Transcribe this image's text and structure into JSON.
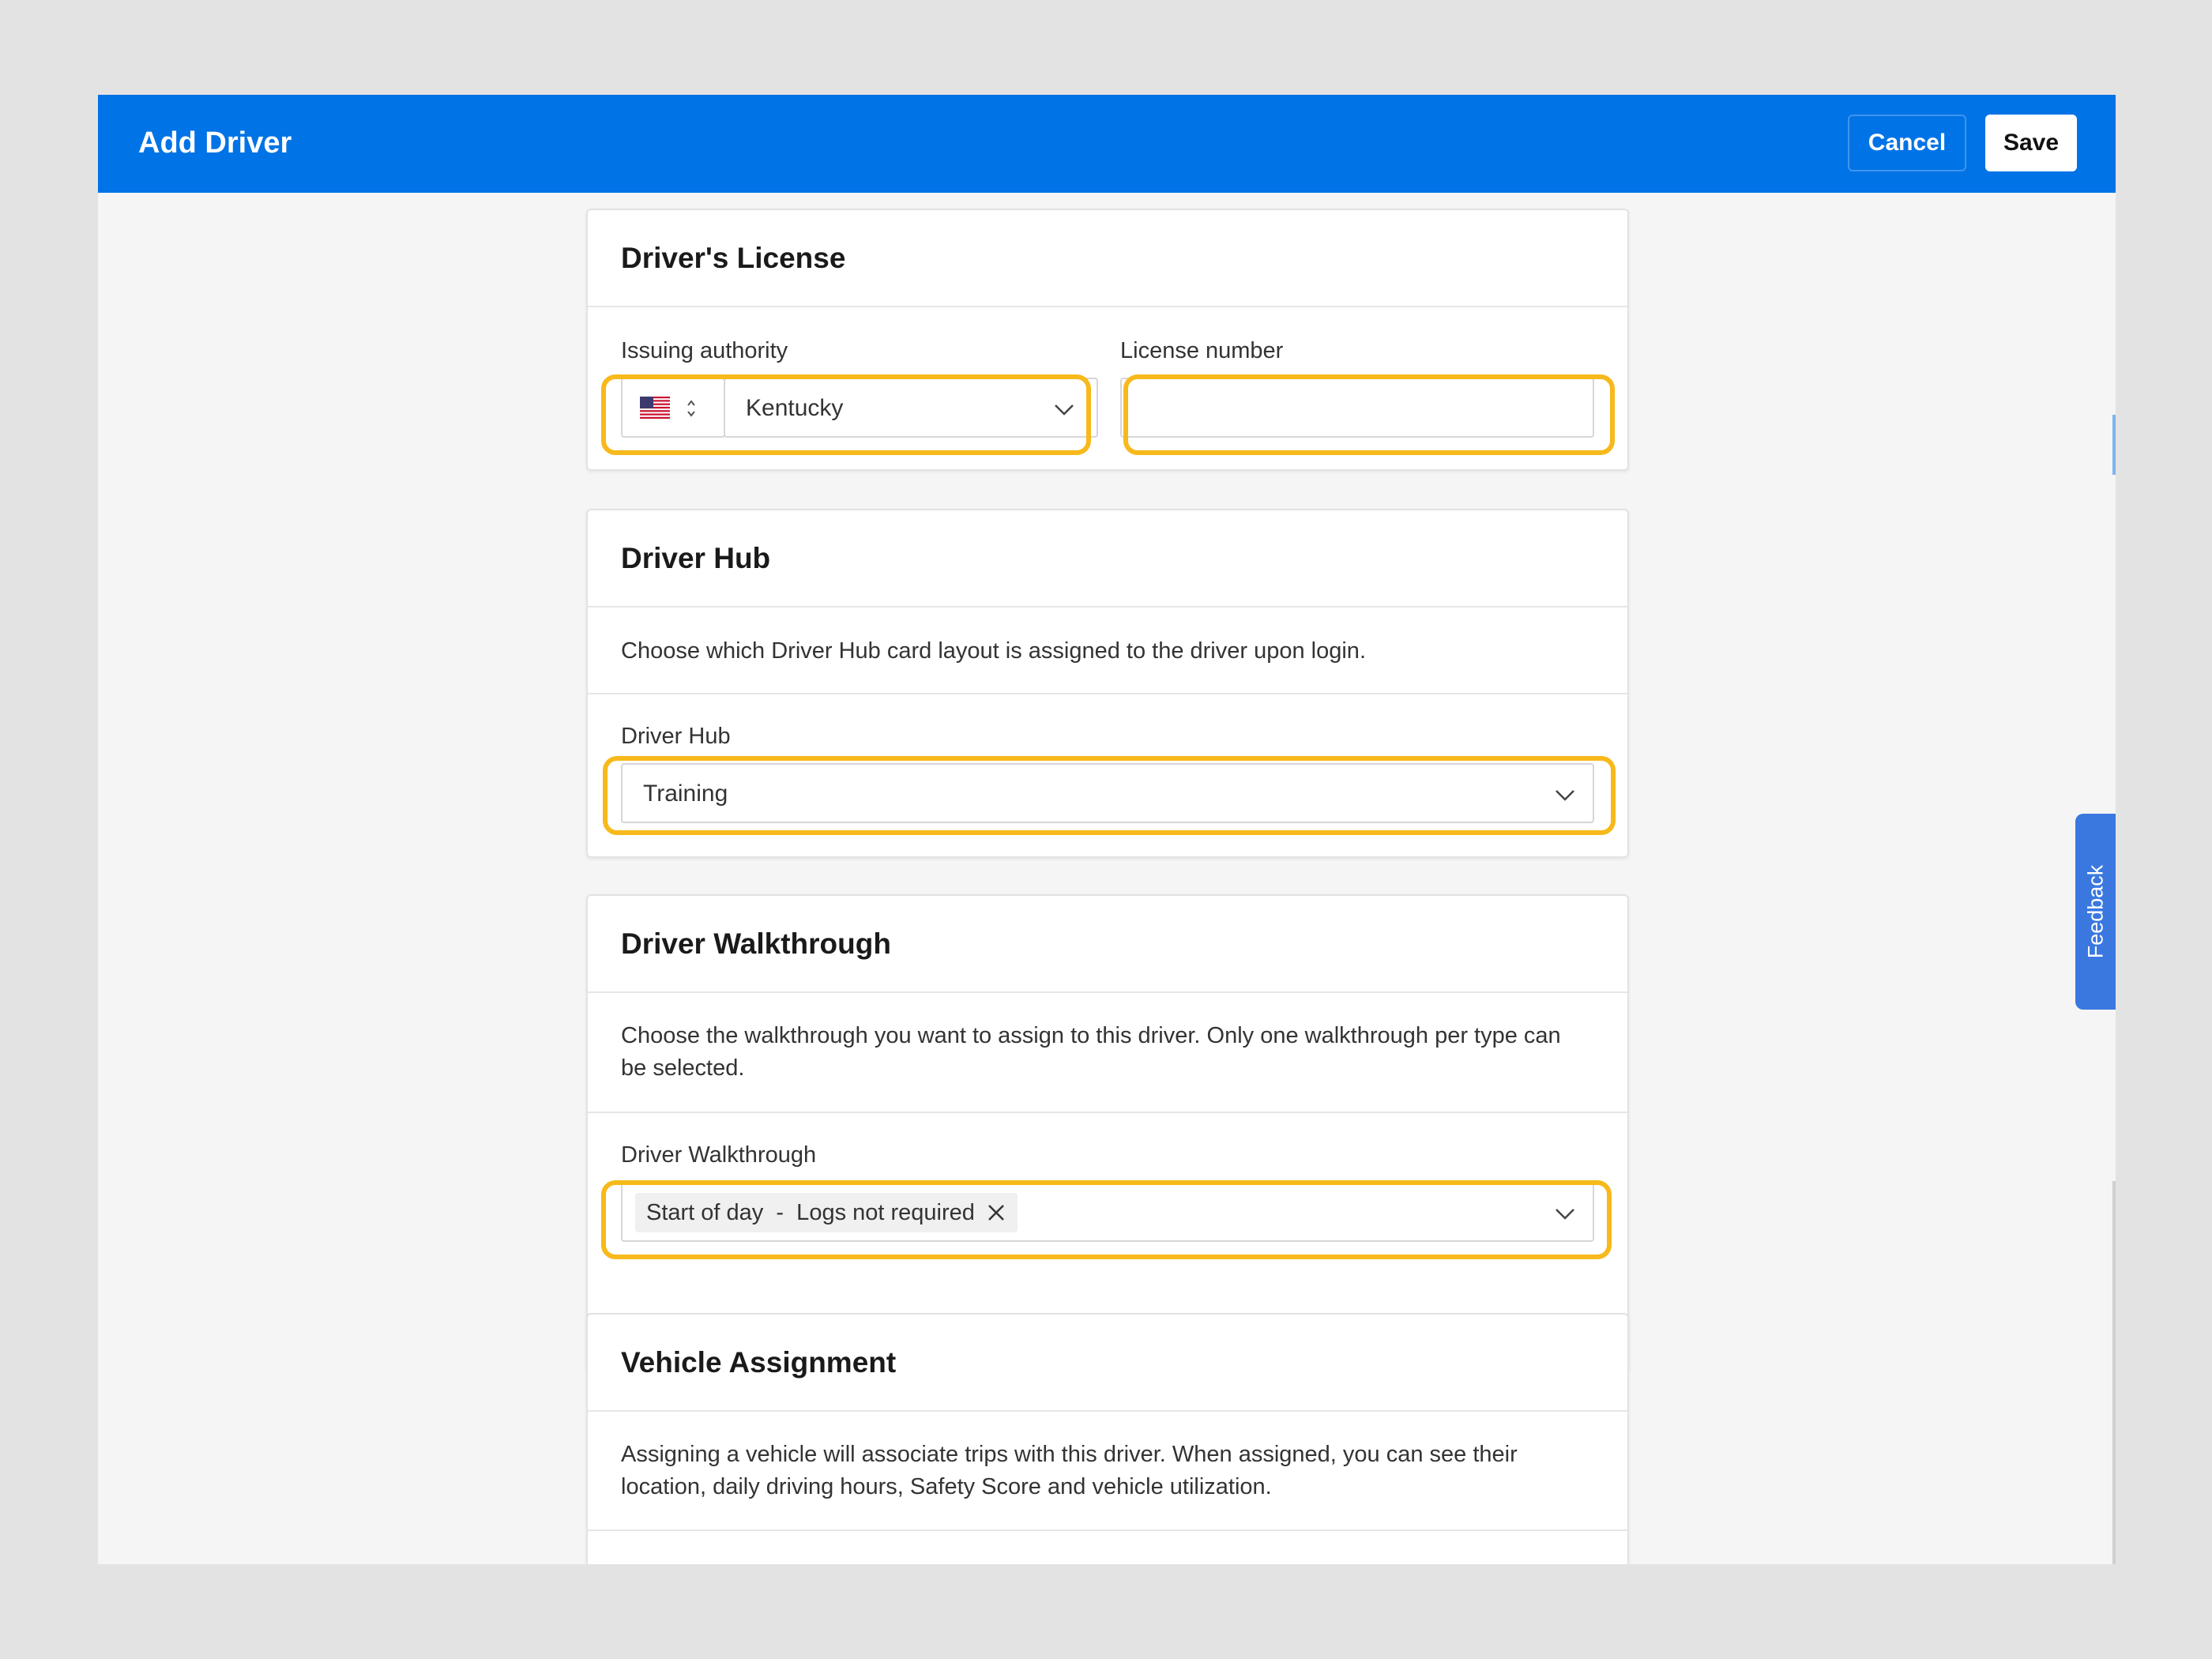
{
  "header": {
    "title": "Add Driver",
    "cancel_label": "Cancel",
    "save_label": "Save"
  },
  "license": {
    "title": "Driver's License",
    "issuing_label": "Issuing authority",
    "issuing_value": "Kentucky",
    "country_flag": "us-flag-icon",
    "license_label": "License number",
    "license_value": ""
  },
  "hub": {
    "title": "Driver Hub",
    "description": "Choose which Driver Hub card layout is assigned to the driver upon login.",
    "field_label": "Driver Hub",
    "value": "Training"
  },
  "walkthrough": {
    "title": "Driver Walkthrough",
    "description": "Choose the walkthrough you want to assign to this driver. Only one walkthrough per type can be selected.",
    "field_label": "Driver Walkthrough",
    "selected_tag": "Start of day  -  Logs not required"
  },
  "vehicle": {
    "title": "Vehicle Assignment",
    "description": "Assigning a vehicle will associate trips with this driver. When assigned, you can see their location, daily driving hours, Safety Score and vehicle utilization."
  },
  "feedback": {
    "label": "Feedback"
  },
  "colors": {
    "header_bg": "#0073e6",
    "highlight": "#f7b91b",
    "feedback_bg": "#3a78e0"
  }
}
